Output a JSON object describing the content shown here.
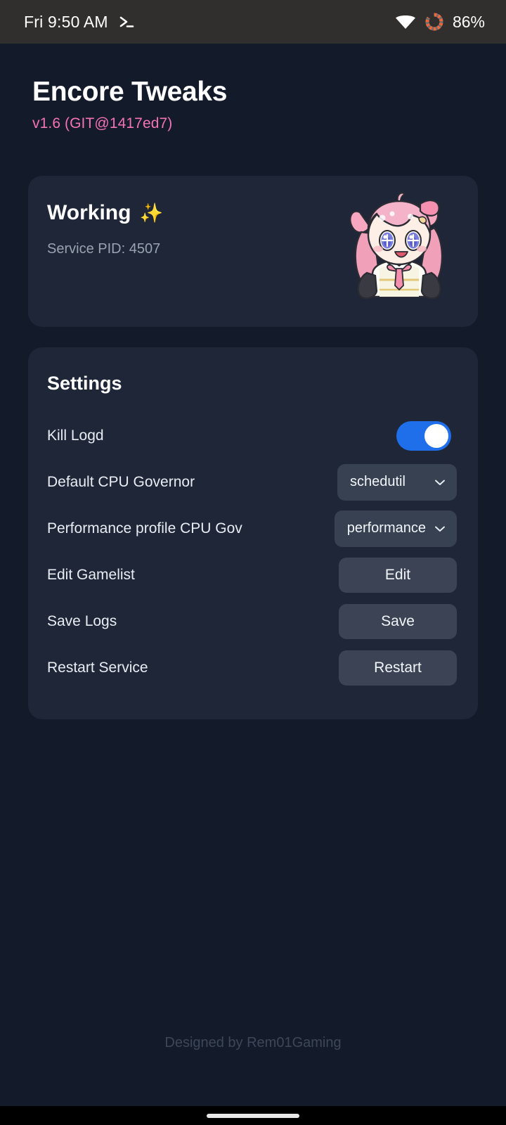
{
  "status_bar": {
    "clock": "Fri 9:50 AM",
    "terminal_icon": "terminal-prompt-icon",
    "wifi_icon": "wifi-icon",
    "battery_icon": "battery-ring-icon",
    "battery_percent": "86%",
    "battery_level": 86,
    "bar_background": "#302f2d"
  },
  "header": {
    "title": "Encore Tweaks",
    "version": "v1.6 (GIT@1417ed7)",
    "version_color": "#f472b6"
  },
  "status_card": {
    "heading": "Working",
    "heading_emoji": "✨",
    "service_pid_label": "Service PID: 4507",
    "mascot_icon": "anime-mascot-illustration",
    "card_background": "#1e2637"
  },
  "settings": {
    "title": "Settings",
    "rows": [
      {
        "label": "Kill Logd",
        "control": "toggle",
        "name": "kill-logd-toggle",
        "value": "on",
        "accent": "#1f6feb"
      },
      {
        "label": "Default CPU Governor",
        "control": "dropdown",
        "name": "default-cpu-governor-dropdown",
        "value": "schedutil"
      },
      {
        "label": "Performance profile CPU Gov",
        "control": "dropdown",
        "name": "performance-profile-cpu-gov-dropdown",
        "value": "performance"
      },
      {
        "label": "Edit Gamelist",
        "control": "button",
        "name": "edit-gamelist-button",
        "value": "Edit"
      },
      {
        "label": "Save Logs",
        "control": "button",
        "name": "save-logs-button",
        "value": "Save"
      },
      {
        "label": "Restart Service",
        "control": "button",
        "name": "restart-service-button",
        "value": "Restart"
      }
    ]
  },
  "footer": {
    "text": "Designed by Rem01Gaming"
  },
  "navigation": {
    "gesture_pill": "home-gesture-pill"
  },
  "theme": {
    "page_background": "#131a29",
    "card_background": "#1e2637",
    "control_background": "#374152",
    "button_background": "#3b4354",
    "text_primary": "#ffffff",
    "text_secondary": "#9aa3b2",
    "accent_pink": "#f472b6",
    "accent_blue": "#1f6feb",
    "battery_orange": "#f4663a"
  }
}
